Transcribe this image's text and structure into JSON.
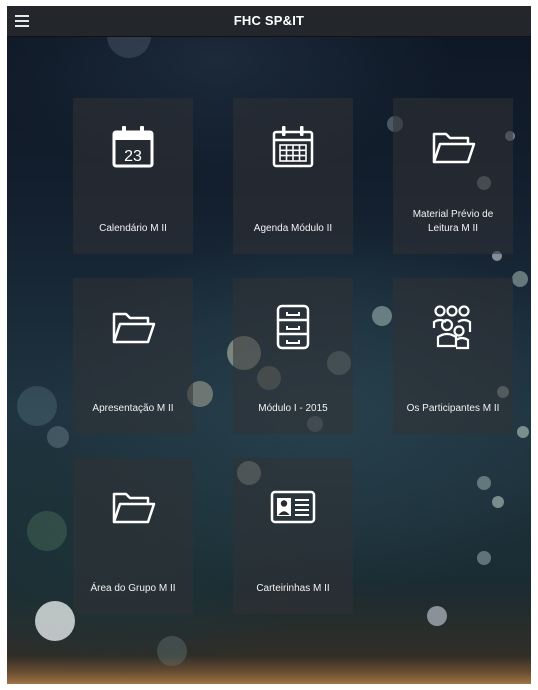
{
  "app": {
    "title": "FHC SP&IT",
    "menu_icon": "hamburger-menu-icon"
  },
  "tiles": [
    {
      "label": "Calendário M II",
      "icon": "calendar-day-icon",
      "day": "23"
    },
    {
      "label": "Agenda Módulo II",
      "icon": "calendar-grid-icon"
    },
    {
      "label": "Material Prévio de Leitura M II",
      "icon": "folder-icon"
    },
    {
      "label": "Apresentação M II",
      "icon": "folder-icon"
    },
    {
      "label": "Módulo I - 2015",
      "icon": "filing-cabinet-icon"
    },
    {
      "label": "Os Participantes M II",
      "icon": "people-group-icon"
    },
    {
      "label": "Área do Grupo M II",
      "icon": "folder-icon"
    },
    {
      "label": "Carteirinhas M II",
      "icon": "id-card-icon"
    }
  ]
}
